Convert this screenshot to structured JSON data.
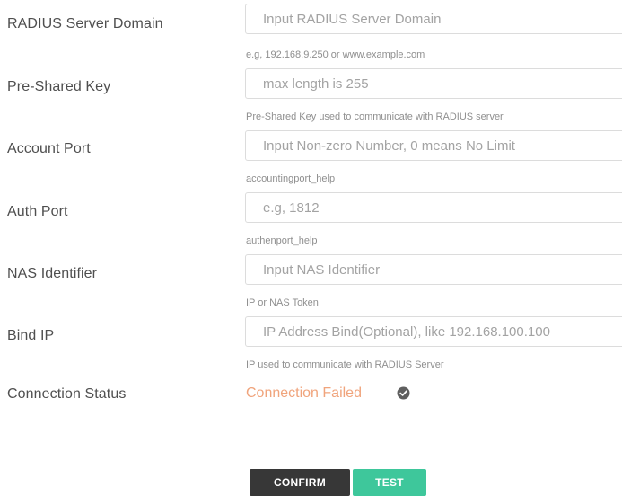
{
  "fields": [
    {
      "label": "RADIUS Server Domain",
      "value": "",
      "placeholder": "Input RADIUS Server Domain",
      "help": "e.g, 192.168.9.250 or www.example.com"
    },
    {
      "label": "Pre-Shared Key",
      "value": "",
      "placeholder": "max length is 255",
      "help": "Pre-Shared Key used to communicate with RADIUS server"
    },
    {
      "label": "Account Port",
      "value": "",
      "placeholder": "Input Non-zero Number, 0 means No Limit",
      "help": "accountingport_help"
    },
    {
      "label": "Auth Port",
      "value": "",
      "placeholder": "e.g, 1812",
      "help": "authenport_help"
    },
    {
      "label": "NAS Identifier",
      "value": "",
      "placeholder": "Input NAS Identifier",
      "help": "IP or NAS Token"
    },
    {
      "label": "Bind IP",
      "value": "",
      "placeholder": "IP Address Bind(Optional), like 192.168.100.100",
      "help": "IP used to communicate with RADIUS Server"
    }
  ],
  "connection": {
    "label": "Connection Status",
    "status": "Connection Failed",
    "status_color": "#f0a47c",
    "icon": "check-circle-icon"
  },
  "buttons": {
    "confirm": "CONFIRM",
    "test": "TEST"
  },
  "colors": {
    "confirm_bg": "#373737",
    "test_bg": "#3ec79b"
  }
}
